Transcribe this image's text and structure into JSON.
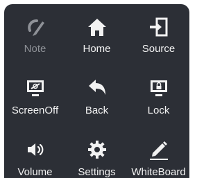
{
  "menu": {
    "items": [
      {
        "label": "Note",
        "icon": "pen-icon",
        "disabled": true
      },
      {
        "label": "Home",
        "icon": "home-icon",
        "disabled": false
      },
      {
        "label": "Source",
        "icon": "source-icon",
        "disabled": false
      },
      {
        "label": "ScreenOff",
        "icon": "screen-off-icon",
        "disabled": false
      },
      {
        "label": "Back",
        "icon": "back-arrow-icon",
        "disabled": false
      },
      {
        "label": "Lock",
        "icon": "lock-icon",
        "disabled": false
      },
      {
        "label": "Volume",
        "icon": "volume-icon",
        "disabled": false
      },
      {
        "label": "Settings",
        "icon": "gear-icon",
        "disabled": false
      },
      {
        "label": "WhiteBoard",
        "icon": "pencil-icon",
        "disabled": false
      }
    ]
  },
  "colors": {
    "panel_background": "#2c2f36",
    "icon": "#f2f2f2",
    "icon_disabled": "#8e9197"
  }
}
